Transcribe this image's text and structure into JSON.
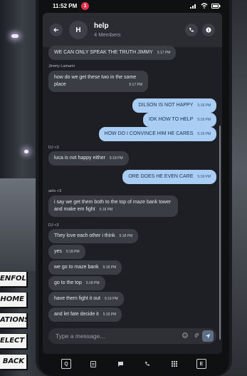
{
  "status_bar": {
    "time": "11:52 PM",
    "notification_count": "1"
  },
  "chat": {
    "avatar_initial": "H",
    "title": "help",
    "subtitle": "4 Members"
  },
  "messages": [
    {
      "dir": "in",
      "text": "WE CAN ONLY SPEAK THE TRUTH JIMMY",
      "time": "5:17 PM",
      "sender": ""
    },
    {
      "dir": "in",
      "text": "how do we get these two in the same place",
      "time": "5:17 PM",
      "sender": "Jimmy Lamami"
    },
    {
      "dir": "out",
      "text": "DILSON IS NOT HAPPY",
      "time": "5:18 PM",
      "sender": ""
    },
    {
      "dir": "out",
      "text": "IDK HOW TO HELP",
      "time": "5:18 PM",
      "sender": ""
    },
    {
      "dir": "out",
      "text": "HOW DO I CONVINCE HIM HE CARES",
      "time": "5:18 PM",
      "sender": ""
    },
    {
      "dir": "in",
      "text": "luca is not happy either",
      "time": "5:18 PM",
      "sender": "DJ <3"
    },
    {
      "dir": "out",
      "text": "ORE DOES HE EVEN CARE",
      "time": "5:18 PM",
      "sender": ""
    },
    {
      "dir": "in",
      "text": "i say we get them both to the top of maze bank tower and make em fight",
      "time": "5:18 PM",
      "sender": "aelo <3"
    },
    {
      "dir": "in",
      "text": "They love each other i think",
      "time": "5:18 PM",
      "sender": "DJ <3"
    },
    {
      "dir": "in",
      "text": "yes",
      "time": "5:18 PM",
      "sender": ""
    },
    {
      "dir": "in",
      "text": "we go to maze bank",
      "time": "5:18 PM",
      "sender": ""
    },
    {
      "dir": "in",
      "text": "go to the top",
      "time": "5:18 PM",
      "sender": ""
    },
    {
      "dir": "in",
      "text": "have them fight it out",
      "time": "5:19 PM",
      "sender": ""
    },
    {
      "dir": "in",
      "text": "and let fate decide it",
      "time": "5:19 PM",
      "sender": ""
    }
  ],
  "compose": {
    "placeholder": "Type a message..."
  },
  "side_menu": [
    "ENFOLD",
    "HOME",
    "ATIONS",
    "ELECT",
    "BACK"
  ],
  "dock": {
    "left_label": "Q",
    "right_label": "E"
  },
  "icons": {
    "back": "arrow-left-icon",
    "call": "phone-icon",
    "info": "info-icon",
    "emoji": "smile-icon",
    "attach": "paperclip-icon",
    "send": "send-icon"
  },
  "colors": {
    "outgoing_bubble": "#a9cdf3",
    "incoming_bubble": "#3a3d43",
    "badge": "#e0314b"
  }
}
